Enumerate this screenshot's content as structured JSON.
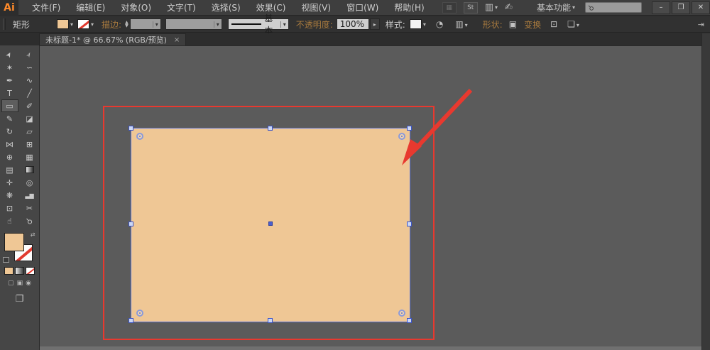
{
  "app": {
    "logo": "Ai"
  },
  "menu_bar": {
    "items": [
      {
        "label": "文件(F)"
      },
      {
        "label": "编辑(E)"
      },
      {
        "label": "对象(O)"
      },
      {
        "label": "文字(T)"
      },
      {
        "label": "选择(S)"
      },
      {
        "label": "效果(C)"
      },
      {
        "label": "视图(V)"
      },
      {
        "label": "窗口(W)"
      },
      {
        "label": "帮助(H)"
      }
    ],
    "stock_icon_text": "St",
    "workspace": "基本功能",
    "workspace_arrow": "▾",
    "arrange_arrow": "▾"
  },
  "window_controls": {
    "minimize": "–",
    "restore": "❐",
    "close": "✕"
  },
  "control_bar": {
    "tool_label": "矩形",
    "stroke_label": "描边:",
    "stroke_value": "",
    "profile_value": "",
    "brush_label": "基本",
    "opacity_label": "不透明度:",
    "opacity_value": "100%",
    "style_label": "样式:",
    "shape_label": "形状:",
    "transform_label": "变换",
    "fill_color": "#efc795",
    "link_color": "#a87a3e"
  },
  "tab_bar": {
    "tabs": [
      {
        "title": "未标题-1* @ 66.67% (RGB/预览)",
        "close_glyph": "×"
      }
    ]
  },
  "toolbar": {
    "tools": [
      {
        "name": "selection",
        "glyph": "➤"
      },
      {
        "name": "direct-selection",
        "glyph": "➢"
      },
      {
        "name": "magic-wand",
        "glyph": "✶"
      },
      {
        "name": "lasso",
        "glyph": "∽"
      },
      {
        "name": "pen",
        "glyph": "✒"
      },
      {
        "name": "curvature",
        "glyph": "∿"
      },
      {
        "name": "type",
        "glyph": "T"
      },
      {
        "name": "line-segment",
        "glyph": "╱"
      },
      {
        "name": "rectangle",
        "glyph": "▭"
      },
      {
        "name": "paintbrush",
        "glyph": "✐"
      },
      {
        "name": "pencil",
        "glyph": "✎"
      },
      {
        "name": "eraser",
        "glyph": "◪"
      },
      {
        "name": "rotate",
        "glyph": "↻"
      },
      {
        "name": "scale",
        "glyph": "▱"
      },
      {
        "name": "width",
        "glyph": "⋈"
      },
      {
        "name": "free-transform",
        "glyph": "⊞"
      },
      {
        "name": "shape-builder",
        "glyph": "⊕"
      },
      {
        "name": "perspective-grid",
        "glyph": "▦"
      },
      {
        "name": "mesh",
        "glyph": "▤"
      },
      {
        "name": "gradient",
        "glyph": ""
      },
      {
        "name": "eyedropper",
        "glyph": "✛"
      },
      {
        "name": "blend",
        "glyph": "◎"
      },
      {
        "name": "symbol-sprayer",
        "glyph": "❋"
      },
      {
        "name": "column-graph",
        "glyph": "▃▆"
      },
      {
        "name": "artboard",
        "glyph": "⊡"
      },
      {
        "name": "slice",
        "glyph": "✂"
      },
      {
        "name": "hand",
        "glyph": "☝"
      },
      {
        "name": "zoom",
        "glyph": "⚲"
      }
    ],
    "active_tool": "rectangle",
    "fill_color": "#efc795",
    "stroke_style": "none",
    "draw_modes": [
      {
        "glyph": "▢"
      },
      {
        "glyph": "▣"
      },
      {
        "glyph": "◉"
      }
    ],
    "screen_mode_glyph": "❐",
    "swap_glyph": "⤴"
  },
  "canvas": {
    "background": "#5b5b5b",
    "artwork_rect": {
      "fill": "#efc795",
      "selection_color": "#4a5fd0"
    },
    "annotation": {
      "rect_color": "#e8392f",
      "arrow_color": "#e8392f"
    }
  }
}
